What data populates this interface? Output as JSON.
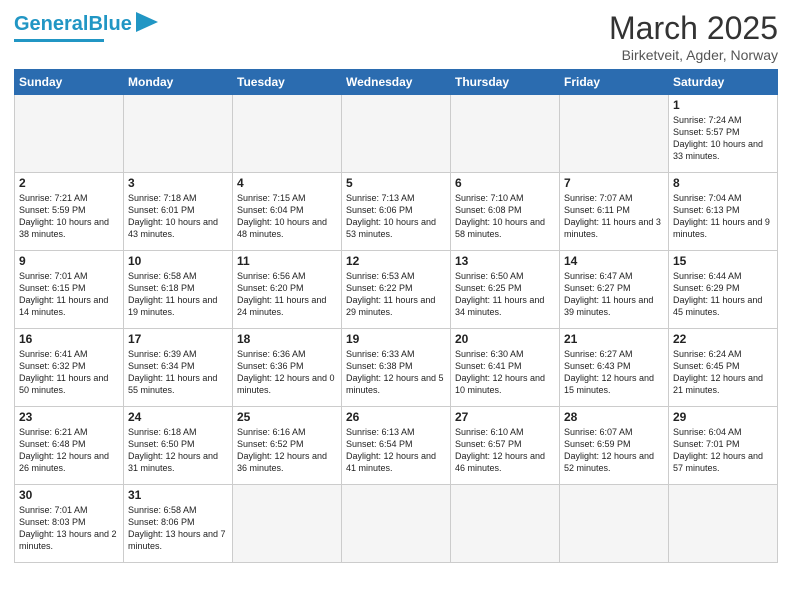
{
  "header": {
    "logo_general": "General",
    "logo_blue": "Blue",
    "month_title": "March 2025",
    "location": "Birketveit, Agder, Norway"
  },
  "weekdays": [
    "Sunday",
    "Monday",
    "Tuesday",
    "Wednesday",
    "Thursday",
    "Friday",
    "Saturday"
  ],
  "weeks": [
    [
      {
        "day": "",
        "info": ""
      },
      {
        "day": "",
        "info": ""
      },
      {
        "day": "",
        "info": ""
      },
      {
        "day": "",
        "info": ""
      },
      {
        "day": "",
        "info": ""
      },
      {
        "day": "",
        "info": ""
      },
      {
        "day": "1",
        "info": "Sunrise: 7:24 AM\nSunset: 5:57 PM\nDaylight: 10 hours\nand 33 minutes."
      }
    ],
    [
      {
        "day": "2",
        "info": "Sunrise: 7:21 AM\nSunset: 5:59 PM\nDaylight: 10 hours\nand 38 minutes."
      },
      {
        "day": "3",
        "info": "Sunrise: 7:18 AM\nSunset: 6:01 PM\nDaylight: 10 hours\nand 43 minutes."
      },
      {
        "day": "4",
        "info": "Sunrise: 7:15 AM\nSunset: 6:04 PM\nDaylight: 10 hours\nand 48 minutes."
      },
      {
        "day": "5",
        "info": "Sunrise: 7:13 AM\nSunset: 6:06 PM\nDaylight: 10 hours\nand 53 minutes."
      },
      {
        "day": "6",
        "info": "Sunrise: 7:10 AM\nSunset: 6:08 PM\nDaylight: 10 hours\nand 58 minutes."
      },
      {
        "day": "7",
        "info": "Sunrise: 7:07 AM\nSunset: 6:11 PM\nDaylight: 11 hours\nand 3 minutes."
      },
      {
        "day": "8",
        "info": "Sunrise: 7:04 AM\nSunset: 6:13 PM\nDaylight: 11 hours\nand 9 minutes."
      }
    ],
    [
      {
        "day": "9",
        "info": "Sunrise: 7:01 AM\nSunset: 6:15 PM\nDaylight: 11 hours\nand 14 minutes."
      },
      {
        "day": "10",
        "info": "Sunrise: 6:58 AM\nSunset: 6:18 PM\nDaylight: 11 hours\nand 19 minutes."
      },
      {
        "day": "11",
        "info": "Sunrise: 6:56 AM\nSunset: 6:20 PM\nDaylight: 11 hours\nand 24 minutes."
      },
      {
        "day": "12",
        "info": "Sunrise: 6:53 AM\nSunset: 6:22 PM\nDaylight: 11 hours\nand 29 minutes."
      },
      {
        "day": "13",
        "info": "Sunrise: 6:50 AM\nSunset: 6:25 PM\nDaylight: 11 hours\nand 34 minutes."
      },
      {
        "day": "14",
        "info": "Sunrise: 6:47 AM\nSunset: 6:27 PM\nDaylight: 11 hours\nand 39 minutes."
      },
      {
        "day": "15",
        "info": "Sunrise: 6:44 AM\nSunset: 6:29 PM\nDaylight: 11 hours\nand 45 minutes."
      }
    ],
    [
      {
        "day": "16",
        "info": "Sunrise: 6:41 AM\nSunset: 6:32 PM\nDaylight: 11 hours\nand 50 minutes."
      },
      {
        "day": "17",
        "info": "Sunrise: 6:39 AM\nSunset: 6:34 PM\nDaylight: 11 hours\nand 55 minutes."
      },
      {
        "day": "18",
        "info": "Sunrise: 6:36 AM\nSunset: 6:36 PM\nDaylight: 12 hours\nand 0 minutes."
      },
      {
        "day": "19",
        "info": "Sunrise: 6:33 AM\nSunset: 6:38 PM\nDaylight: 12 hours\nand 5 minutes."
      },
      {
        "day": "20",
        "info": "Sunrise: 6:30 AM\nSunset: 6:41 PM\nDaylight: 12 hours\nand 10 minutes."
      },
      {
        "day": "21",
        "info": "Sunrise: 6:27 AM\nSunset: 6:43 PM\nDaylight: 12 hours\nand 15 minutes."
      },
      {
        "day": "22",
        "info": "Sunrise: 6:24 AM\nSunset: 6:45 PM\nDaylight: 12 hours\nand 21 minutes."
      }
    ],
    [
      {
        "day": "23",
        "info": "Sunrise: 6:21 AM\nSunset: 6:48 PM\nDaylight: 12 hours\nand 26 minutes."
      },
      {
        "day": "24",
        "info": "Sunrise: 6:18 AM\nSunset: 6:50 PM\nDaylight: 12 hours\nand 31 minutes."
      },
      {
        "day": "25",
        "info": "Sunrise: 6:16 AM\nSunset: 6:52 PM\nDaylight: 12 hours\nand 36 minutes."
      },
      {
        "day": "26",
        "info": "Sunrise: 6:13 AM\nSunset: 6:54 PM\nDaylight: 12 hours\nand 41 minutes."
      },
      {
        "day": "27",
        "info": "Sunrise: 6:10 AM\nSunset: 6:57 PM\nDaylight: 12 hours\nand 46 minutes."
      },
      {
        "day": "28",
        "info": "Sunrise: 6:07 AM\nSunset: 6:59 PM\nDaylight: 12 hours\nand 52 minutes."
      },
      {
        "day": "29",
        "info": "Sunrise: 6:04 AM\nSunset: 7:01 PM\nDaylight: 12 hours\nand 57 minutes."
      }
    ],
    [
      {
        "day": "30",
        "info": "Sunrise: 7:01 AM\nSunset: 8:03 PM\nDaylight: 13 hours\nand 2 minutes."
      },
      {
        "day": "31",
        "info": "Sunrise: 6:58 AM\nSunset: 8:06 PM\nDaylight: 13 hours\nand 7 minutes."
      },
      {
        "day": "",
        "info": ""
      },
      {
        "day": "",
        "info": ""
      },
      {
        "day": "",
        "info": ""
      },
      {
        "day": "",
        "info": ""
      },
      {
        "day": "",
        "info": ""
      }
    ]
  ]
}
